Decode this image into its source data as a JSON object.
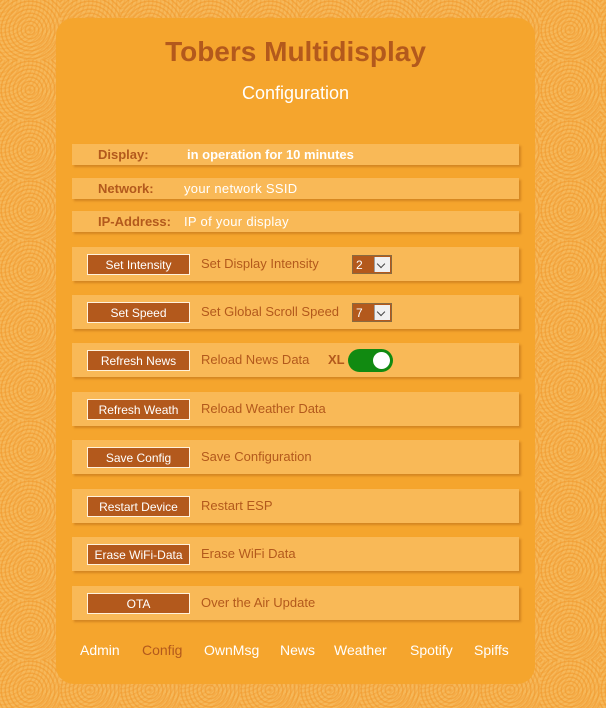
{
  "header": {
    "title": "Tobers Multidisplay",
    "subtitle": "Configuration"
  },
  "info": [
    {
      "label": "Display:",
      "value": "in operation for 10 minutes"
    },
    {
      "label": "Network:",
      "value": "your network SSID"
    },
    {
      "label": "IP-Address:",
      "value": "IP of your display"
    }
  ],
  "actions": {
    "intensity": {
      "button": "Set Intensity",
      "desc": "Set Display Intensity",
      "selected": "2"
    },
    "speed": {
      "button": "Set Speed",
      "desc": "Set Global Scroll Speed",
      "selected": "7"
    },
    "news": {
      "button": "Refresh News",
      "desc": "Reload News Data",
      "toggle_label": "XL",
      "toggle_on": true
    },
    "weather": {
      "button": "Refresh Weath",
      "desc": "Reload Weather Data"
    },
    "save": {
      "button": "Save Config",
      "desc": "Save Configuration"
    },
    "restart": {
      "button": "Restart Device",
      "desc": "Restart ESP"
    },
    "erase": {
      "button": "Erase WiFi-Data",
      "desc": "Erase WiFi Data"
    },
    "ota": {
      "button": "OTA",
      "desc": "Over the Air Update"
    }
  },
  "nav": [
    "Admin",
    "Config",
    "OwnMsg",
    "News",
    "Weather",
    "Spotify",
    "Spiffs"
  ],
  "nav_active": "Config",
  "colors": {
    "background": "#f6b85a",
    "panel": "#f5a52d",
    "row": "#f9b957",
    "accent": "#b3591c",
    "toggle_on": "#118a11"
  }
}
